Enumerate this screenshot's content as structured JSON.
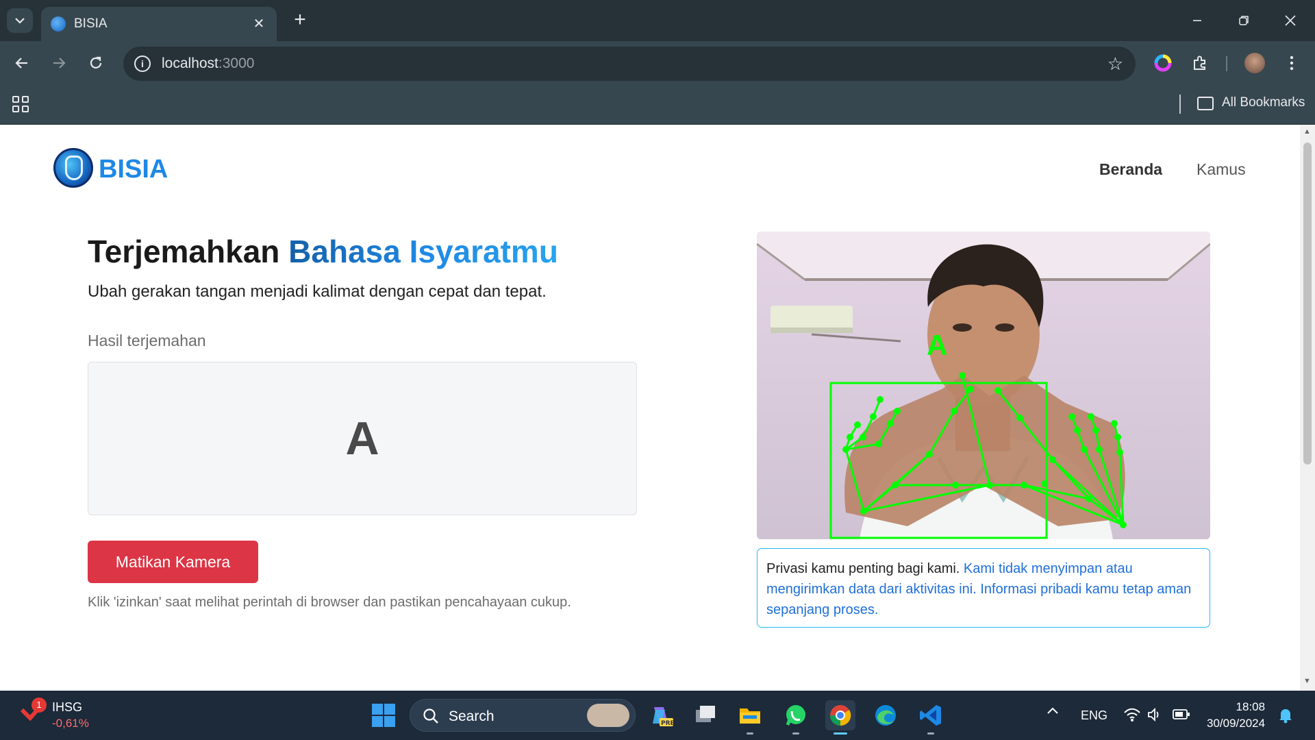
{
  "browser": {
    "tab_title": "BISIA",
    "url_host": "localhost",
    "url_port": ":3000",
    "bookmarks_label": "All Bookmarks"
  },
  "site": {
    "brand": "BISIA",
    "nav": [
      {
        "label": "Beranda",
        "active": true
      },
      {
        "label": "Kamus",
        "active": false
      }
    ]
  },
  "hero": {
    "title_plain": "Terjemahkan ",
    "title_accent": "Bahasa Isyaratmu",
    "subtitle": "Ubah gerakan tangan menjadi kalimat dengan cepat dan tepat."
  },
  "translator": {
    "result_label": "Hasil terjemahan",
    "result_value": "A",
    "camera_button": "Matikan Kamera",
    "hint": "Klik 'izinkan' saat melihat perintah di browser dan pastikan pencahayaan cukup."
  },
  "camera": {
    "detected_letter": "A",
    "overlay_color": "#00ff00"
  },
  "privacy": {
    "lead": "Privasi kamu penting bagi kami.",
    "detail": "Kami tidak menyimpan atau mengirimkan data dari aktivitas ini. Informasi pribadi kamu tetap aman sepanjang proses."
  },
  "taskbar": {
    "stock_name": "IHSG",
    "stock_change": "-0,61%",
    "notification_count": "1",
    "search_label": "Search",
    "language": "ENG",
    "time": "18:08",
    "date": "30/09/2024"
  },
  "colors": {
    "accent": "#1e88e5",
    "danger": "#dc3545",
    "privacy_border": "#29b6f6"
  }
}
